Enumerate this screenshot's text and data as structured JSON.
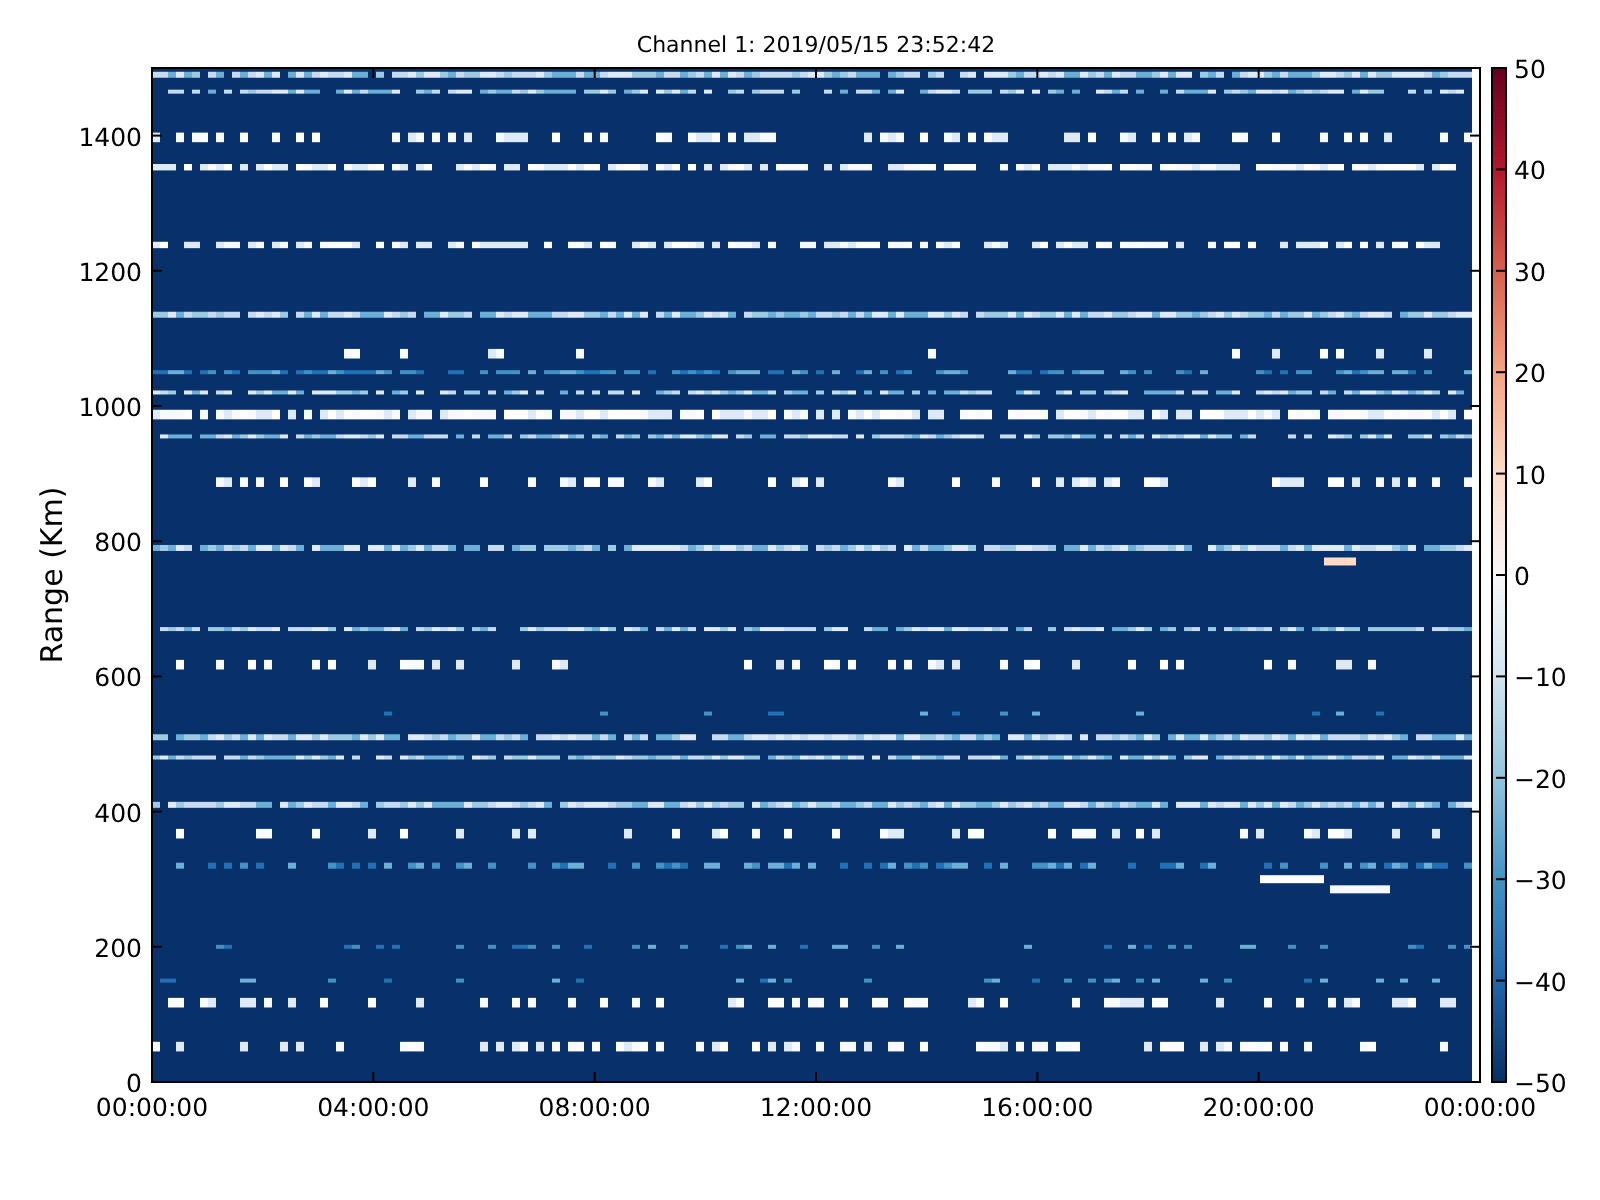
{
  "title": "Channel 1: 2019/05/15 23:52:42",
  "ylabel": "Range (Km)",
  "xticks": [
    "00:00:00",
    "04:00:00",
    "08:00:00",
    "12:00:00",
    "16:00:00",
    "20:00:00",
    "00:00:00"
  ],
  "yticks": [
    "1400",
    "1200",
    "1000",
    "800",
    "600",
    "400",
    "200",
    "0"
  ],
  "colorbar": {
    "ticks": [
      "50",
      "40",
      "30",
      "20",
      "10",
      "0",
      "−10",
      "−20",
      "−30",
      "−40",
      "−50"
    ]
  }
}
